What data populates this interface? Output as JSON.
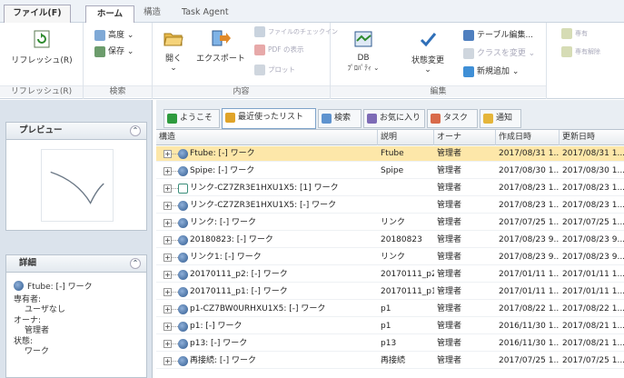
{
  "ribbon_tabs": [
    {
      "label": "ファイル(F)"
    },
    {
      "label": "ホーム"
    },
    {
      "label": "構造"
    },
    {
      "label": "Task Agent"
    }
  ],
  "ribbon": {
    "refresh_label": "リフレッシュ(R)",
    "advanced_label": "高度 ⌄",
    "save_label": "保存 ⌄",
    "open_label": "開く",
    "open_sub": "⌄",
    "export_label": "エクスポート",
    "file_check_label": "ファイルのチェックイン",
    "pdf_label": "PDF の表示",
    "plot_label": "プロット",
    "db_label": "DB",
    "db_sub": "ﾌﾟﾛﾊﾟﾃｨ ⌄",
    "state_change_label": "状態変更",
    "state_change_sub": "⌄",
    "table_edit_label": "テーブル編集...",
    "class_change_label": "クラスを変更 ⌄",
    "new_add_label": "新規追加 ⌄",
    "g1": "リフレッシュ(R)",
    "g2": "検索",
    "g3": "内容",
    "g4": "編集",
    "r1": "専有",
    "r2": "専有解除"
  },
  "preview_panel": {
    "title": "プレビュー",
    "collapse": "⌃"
  },
  "detail_panel": {
    "title": "詳細",
    "collapse": "⌃",
    "item_name": "Ftube: [-] ワーク",
    "owner_label": "専有者:",
    "owner_value": "ユーザなし",
    "o_label": "オーナ:",
    "o_value": "管理者",
    "state_label": "状態:",
    "state_value": "ワーク"
  },
  "main_tabs": [
    {
      "label": "ようこそ"
    },
    {
      "label": "最近使ったリスト"
    },
    {
      "label": "検索"
    },
    {
      "label": "お気に入り"
    },
    {
      "label": "タスク"
    },
    {
      "label": "通知"
    }
  ],
  "table": {
    "columns": [
      "構造",
      "説明",
      "オーナ",
      "作成日時",
      "更新日時"
    ],
    "rows": [
      {
        "name": "Ftube: [-] ワーク",
        "desc": "Ftube",
        "owner": "管理者",
        "created": "2017/08/31 1...",
        "updated": "2017/08/31 1...",
        "type": "part",
        "selected": true
      },
      {
        "name": "Spipe: [-] ワーク",
        "desc": "Spipe",
        "owner": "管理者",
        "created": "2017/08/30 1...",
        "updated": "2017/08/30 1...",
        "type": "part",
        "selected": false
      },
      {
        "name": "リンク-CZ7ZR3E1HXU1X5: [1] ワーク",
        "desc": "",
        "owner": "管理者",
        "created": "2017/08/23 1...",
        "updated": "2017/08/23 1...",
        "type": "link",
        "selected": false
      },
      {
        "name": "リンク-CZ7ZR3E1HXU1X5: [-] ワーク",
        "desc": "",
        "owner": "管理者",
        "created": "2017/08/23 1...",
        "updated": "2017/08/23 1...",
        "type": "part",
        "selected": false
      },
      {
        "name": "リンク: [-] ワーク",
        "desc": "リンク",
        "owner": "管理者",
        "created": "2017/07/25 1...",
        "updated": "2017/07/25 1...",
        "type": "part",
        "selected": false
      },
      {
        "name": "20180823: [-] ワーク",
        "desc": "20180823",
        "owner": "管理者",
        "created": "2017/08/23 9...",
        "updated": "2017/08/23 9...",
        "type": "part",
        "selected": false
      },
      {
        "name": "リンク1: [-] ワーク",
        "desc": "リンク",
        "owner": "管理者",
        "created": "2017/08/23 9...",
        "updated": "2017/08/23 9...",
        "type": "part",
        "selected": false
      },
      {
        "name": "20170111_p2: [-] ワーク",
        "desc": "20170111_p2",
        "owner": "管理者",
        "created": "2017/01/11 1...",
        "updated": "2017/01/11 1...",
        "type": "part",
        "selected": false
      },
      {
        "name": "20170111_p1: [-] ワーク",
        "desc": "20170111_p1",
        "owner": "管理者",
        "created": "2017/01/11 1...",
        "updated": "2017/01/11 1...",
        "type": "part",
        "selected": false
      },
      {
        "name": "p1-CZ7BW0URHXU1X5: [-] ワーク",
        "desc": "p1",
        "owner": "管理者",
        "created": "2017/08/22 1...",
        "updated": "2017/08/22 1...",
        "type": "part",
        "selected": false
      },
      {
        "name": "p1: [-] ワーク",
        "desc": "p1",
        "owner": "管理者",
        "created": "2016/11/30 1...",
        "updated": "2017/08/21 1...",
        "type": "part",
        "selected": false
      },
      {
        "name": "p13: [-] ワーク",
        "desc": "p13",
        "owner": "管理者",
        "created": "2016/11/30 1...",
        "updated": "2017/08/21 1...",
        "type": "part",
        "selected": false
      },
      {
        "name": "再接続: [-] ワーク",
        "desc": "再接続",
        "owner": "管理者",
        "created": "2017/07/25 1...",
        "updated": "2017/07/25 1...",
        "type": "part",
        "selected": false
      }
    ]
  }
}
